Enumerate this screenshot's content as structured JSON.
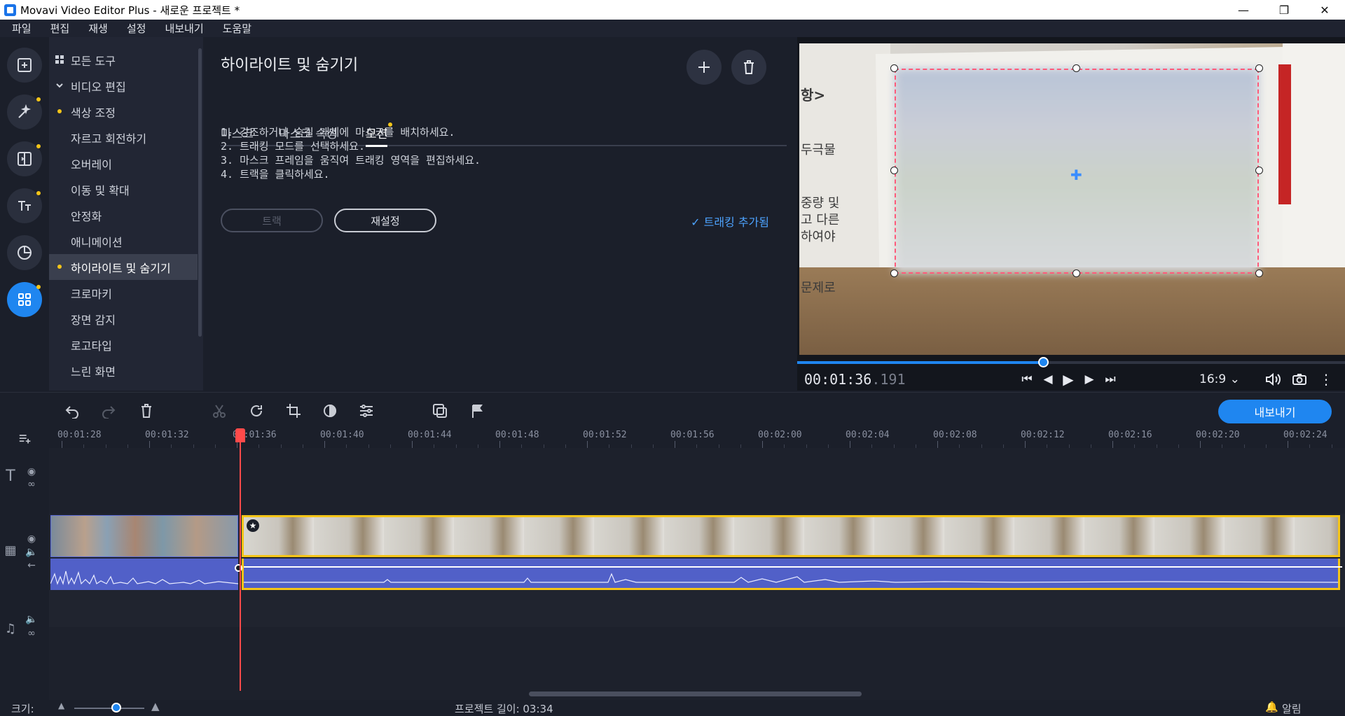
{
  "window": {
    "title": "Movavi Video Editor Plus - 새로운 프로젝트 *"
  },
  "menu": [
    "파일",
    "편집",
    "재생",
    "설정",
    "내보내기",
    "도움말"
  ],
  "icon_rail": [
    {
      "icon": "import-icon"
    },
    {
      "icon": "magic-wand-icon"
    },
    {
      "icon": "transitions-icon"
    },
    {
      "icon": "titles-icon"
    },
    {
      "icon": "stickers-icon"
    },
    {
      "icon": "more-tools-icon"
    }
  ],
  "tools": {
    "all_tools": "모든 도구",
    "video_editing": "비디오 편집",
    "items": [
      "색상 조정",
      "자르고 회전하기",
      "오버레이",
      "이동 및 확대",
      "안정화",
      "애니메이션",
      "하이라이트 및 숨기기",
      "크로마키",
      "장면 감지",
      "로고타입",
      "느린 화면"
    ],
    "selected": "하이라이트 및 숨기기"
  },
  "settings": {
    "heading": "하이라이트 및 숨기기",
    "tabs": [
      "마스크",
      "마스크 속성",
      "모션"
    ],
    "active_tab": "모션",
    "instructions": [
      "1. 강조하거나 숨길 개체에 마스크를 배치하세요.",
      "2. 트래킹 모드를 선택하세요.",
      "3. 마스크 프레임을 움직여 트래킹 영역을 편집하세요.",
      "4. 트랙을 클릭하세요."
    ],
    "track_button": "트랙",
    "reset_button": "재설정",
    "tracking_added": "트래킹 추가됨"
  },
  "preview": {
    "timecode_main": "00:01:36",
    "timecode_ms": ".191",
    "progress": 0.45,
    "aspect_ratio": "16:9",
    "video_text": [
      "항>",
      "두극물",
      "중량 및",
      "고 다른",
      "하여야",
      "문제로"
    ]
  },
  "timeline": {
    "ruler_labels": [
      "00:01:28",
      "00:01:32",
      "00:01:36",
      "00:01:40",
      "00:01:44",
      "00:01:48",
      "00:01:52",
      "00:01:56",
      "00:02:00",
      "00:02:04",
      "00:02:08",
      "00:02:12",
      "00:02:16",
      "00:02:20",
      "00:02:24"
    ],
    "export_button": "내보내기"
  },
  "status": {
    "size_label": "크기:",
    "zoom": 0.6,
    "project_length": "프로젝트 길이: 03:34",
    "notifications": "알림"
  },
  "colors": {
    "accent": "#1f86f0",
    "selection_border": "#f5c518",
    "playhead": "#ff4a4a",
    "mask_border": "#ff5a7a"
  }
}
